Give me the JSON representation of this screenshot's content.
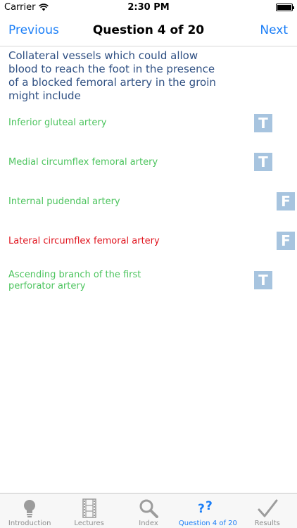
{
  "status": {
    "carrier": "Carrier",
    "time": "2:30 PM",
    "wifi_icon": "wifi-icon",
    "battery_icon": "battery-icon"
  },
  "nav": {
    "previous": "Previous",
    "title": "Question 4 of 20",
    "next": "Next"
  },
  "question": {
    "text": "Collateral vessels which could allow blood to reach the foot in the presence of a blocked femoral artery in the groin might include"
  },
  "answers": [
    {
      "text": "Inferior gluteal artery",
      "badge": "T",
      "color": "#4cc45e"
    },
    {
      "text": "Medial circumflex femoral artery",
      "badge": "T",
      "color": "#4cc45e"
    },
    {
      "text": "Internal pudendal artery",
      "badge": "F",
      "color": "#4cc45e"
    },
    {
      "text": "Lateral circumflex femoral artery",
      "badge": "F",
      "color": "#e0141e"
    },
    {
      "text": "Ascending branch of the first perforator artery",
      "badge": "T",
      "color": "#4cc45e"
    }
  ],
  "colors": {
    "accent": "#1a7ef7",
    "question": "#2e4f82",
    "correct": "#4cc45e",
    "incorrect": "#e0141e",
    "badge": "#a7c4df"
  },
  "tabs": [
    {
      "label": "Introduction",
      "icon": "lightbulb-icon",
      "active": false
    },
    {
      "label": "Lectures",
      "icon": "film-icon",
      "active": false
    },
    {
      "label": "Index",
      "icon": "search-icon",
      "active": false
    },
    {
      "label": "Question 4 of 20",
      "icon": "question-icon",
      "active": true
    },
    {
      "label": "Results",
      "icon": "checkmark-icon",
      "active": false
    }
  ]
}
